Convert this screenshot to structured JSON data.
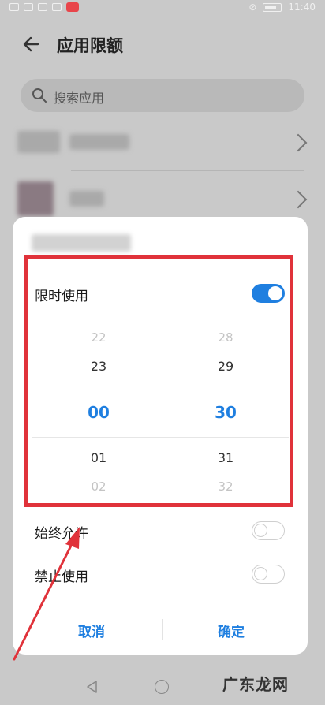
{
  "status_bar": {
    "time": "11:40"
  },
  "header": {
    "title": "应用限额"
  },
  "search": {
    "placeholder": "搜索应用"
  },
  "dialog": {
    "limit_use": {
      "label": "限时使用",
      "enabled": true
    },
    "picker": {
      "hours": [
        "22",
        "23",
        "00",
        "01",
        "02"
      ],
      "minutes": [
        "28",
        "29",
        "30",
        "31",
        "32"
      ],
      "selected_hour": "00",
      "selected_minute": "30"
    },
    "always_allow": {
      "label": "始终允许",
      "enabled": false
    },
    "forbid_use": {
      "label": "禁止使用",
      "enabled": false
    },
    "cancel_label": "取消",
    "confirm_label": "确定"
  },
  "watermark": "广东龙网",
  "colors": {
    "accent": "#1f7fe0",
    "highlight": "#e0323a"
  }
}
